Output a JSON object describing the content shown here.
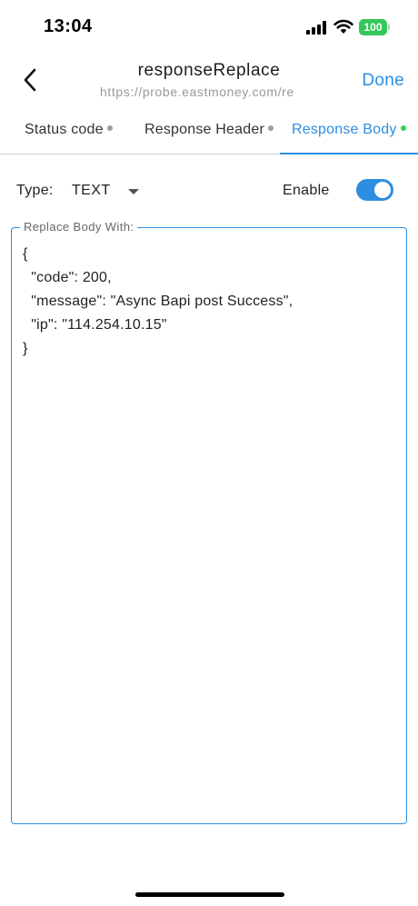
{
  "status_bar": {
    "time": "13:04",
    "battery_level": "100",
    "battery_color": "#34c759",
    "icons": [
      "signal-icon",
      "wifi-icon",
      "battery-icon"
    ]
  },
  "header": {
    "title": "responseReplace",
    "subtitle": "https://probe.eastmoney.com/re",
    "done_label": "Done",
    "back_icon": "chevron-left-icon"
  },
  "tabs": [
    {
      "label": "Status code",
      "active": false
    },
    {
      "label": "Response Header",
      "active": false
    },
    {
      "label": "Response Body",
      "active": true
    }
  ],
  "type_row": {
    "label": "Type:",
    "selected": "TEXT",
    "enable_label": "Enable",
    "enabled": true
  },
  "body_field": {
    "legend": "Replace Body With:",
    "value": "{\n  \"code\": 200,\n  \"message\": \"Async Bapi post Success\",\n  \"ip\": \"114.254.10.15\"\n}"
  },
  "colors": {
    "accent": "#2d8ee0",
    "active_dot": "#2fd24a",
    "inactive_dot": "#9e9e9e"
  }
}
